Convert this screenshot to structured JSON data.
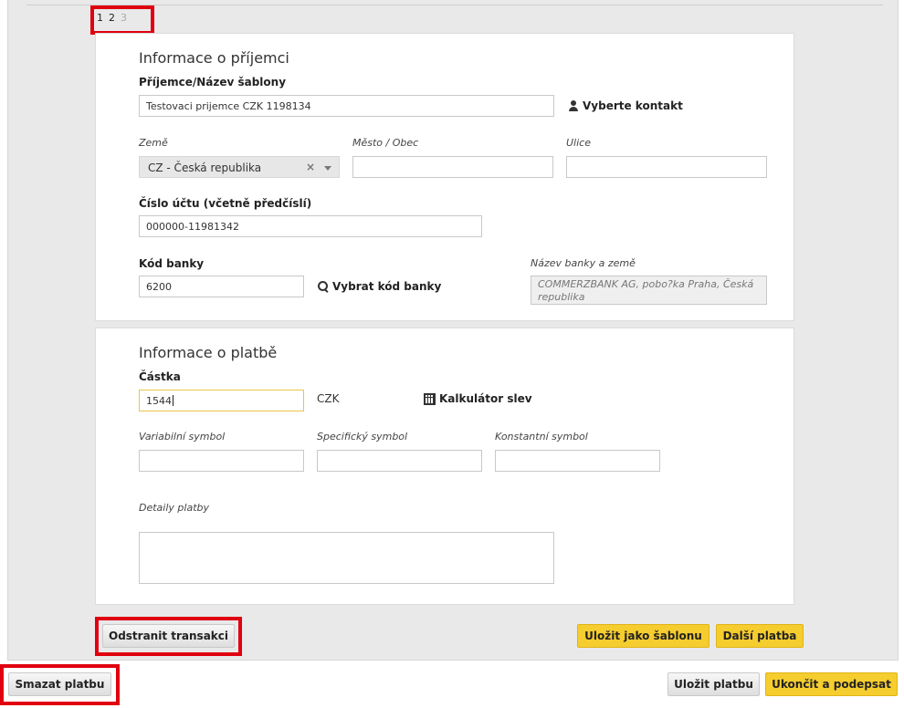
{
  "pager": {
    "pages": [
      "1",
      "2",
      "3"
    ]
  },
  "recipient": {
    "heading": "Informace o příjemci",
    "name_label": "Příjemce/Název šablony",
    "name_value": "Testovaci prijemce CZK 1198134",
    "contact_link": "Vyberte kontakt",
    "country_label": "Země",
    "country_value": "CZ - Česká republika",
    "clear_symbol": "×",
    "city_label": "Město / Obec",
    "city_value": "",
    "street_label": "Ulice",
    "street_value": "",
    "account_label": "Číslo účtu (včetně předčíslí)",
    "account_value": "000000-11981342",
    "bank_code_label": "Kód banky",
    "bank_code_value": "6200",
    "bank_code_link": "Vybrat kód banky",
    "bank_name_label": "Název banky a země",
    "bank_name_value": "COMMERZBANK AG, pobo?ka Praha, Česká republika"
  },
  "payment": {
    "heading": "Informace o platbě",
    "amount_label": "Částka",
    "amount_value": "1544",
    "currency": "CZK",
    "calculator_link": "Kalkulátor slev",
    "variable_label": "Variabilní symbol",
    "specific_label": "Specifický symbol",
    "constant_label": "Konstantní symbol",
    "details_label": "Detaily platby"
  },
  "actions": {
    "remove_transaction": "Odstranit transakci",
    "save_template": "Uložit jako šablonu",
    "next_payment": "Další platba",
    "delete_payment": "Smazat platbu",
    "save_payment": "Uložit platbu",
    "finish_sign": "Ukončit a podepsat"
  },
  "colors": {
    "highlight": "#e0000f",
    "accent": "#f6cd2e",
    "focus_border": "#e8c64a"
  }
}
